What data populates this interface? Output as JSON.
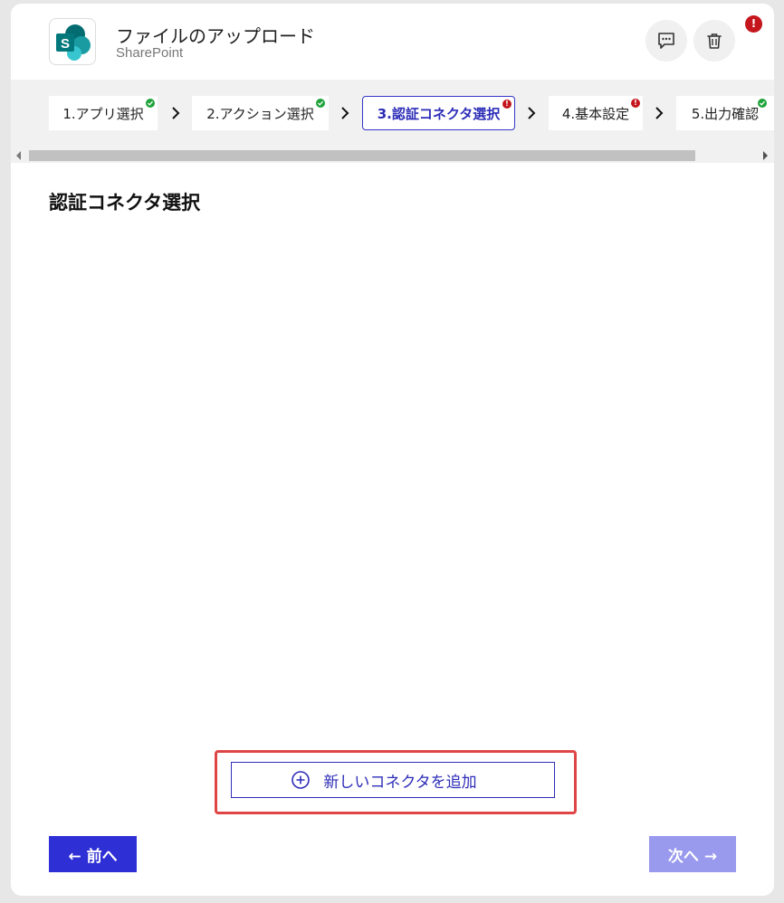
{
  "header": {
    "title": "ファイルのアップロード",
    "subtitle": "SharePoint",
    "alert_badge": "!",
    "logo_letter": "S"
  },
  "colors": {
    "accent": "#2f2fd6",
    "success": "#1fa33a",
    "error": "#c4161c",
    "highlight": "#e04545",
    "disabled": "#9999ee"
  },
  "icons": {
    "chat": "chat-bubble-icon",
    "trash": "trash-icon",
    "add": "plus-circle-icon",
    "chevron": "chevron-right-icon"
  },
  "steps": [
    {
      "label": "1.アプリ選択",
      "status": "ok"
    },
    {
      "label": "2.アクション選択",
      "status": "ok"
    },
    {
      "label": "3.認証コネクタ選択",
      "status": "error",
      "active": true
    },
    {
      "label": "4.基本設定",
      "status": "error"
    },
    {
      "label": "5.出力確認",
      "status": "ok"
    }
  ],
  "main": {
    "section_title": "認証コネクタ選択",
    "add_connector_label": "新しいコネクタを追加"
  },
  "footer": {
    "prev_label": "← 前へ",
    "next_label": "次へ →"
  }
}
